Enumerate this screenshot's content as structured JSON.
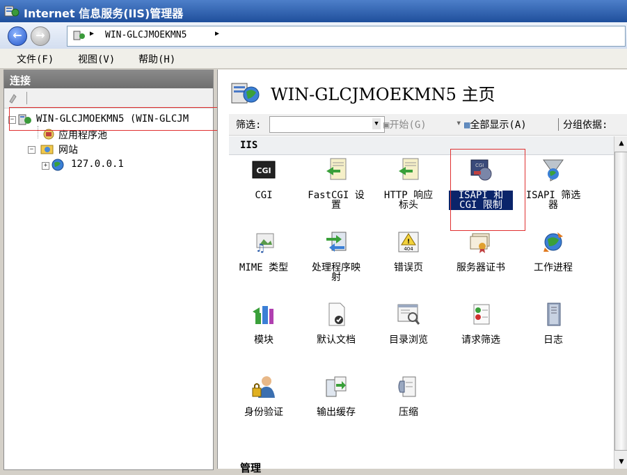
{
  "window": {
    "title": "Internet 信息服务(IIS)管理器"
  },
  "address": {
    "path": "WIN-GLCJMOEKMN5"
  },
  "menu": {
    "items": [
      "文件(F)",
      "视图(V)",
      "帮助(H)"
    ]
  },
  "connections": {
    "header": "连接",
    "tree": {
      "server": "WIN-GLCJMOEKMN5 (WIN-GLCJM",
      "app_pools": "应用程序池",
      "sites": "网站",
      "site1": "127.0.0.1"
    }
  },
  "home": {
    "title": "WIN-GLCJMOEKMN5 主页"
  },
  "filterbar": {
    "label": "筛选:",
    "start": "开始(G)",
    "show_all": "全部显示(A)",
    "group_by": "分组依据:"
  },
  "sections": {
    "iis": "IIS",
    "manage": "管理"
  },
  "features": [
    {
      "label": "CGI",
      "icon": "cgi-icon"
    },
    {
      "label": "FastCGI 设\n置",
      "icon": "fastcgi-icon"
    },
    {
      "label": "HTTP 响应\n标头",
      "icon": "http-headers-icon"
    },
    {
      "label": "ISAPI 和\nCGI 限制",
      "icon": "isapi-cgi-icon",
      "selected": true
    },
    {
      "label": "ISAPI 筛选\n器",
      "icon": "isapi-filter-icon"
    },
    {
      "label": "MIME 类型",
      "icon": "mime-icon"
    },
    {
      "label": "处理程序映\n射",
      "icon": "handler-mapping-icon"
    },
    {
      "label": "错误页",
      "icon": "error-page-icon",
      "badge": "404"
    },
    {
      "label": "服务器证书",
      "icon": "certificate-icon"
    },
    {
      "label": "工作进程",
      "icon": "worker-process-icon"
    },
    {
      "label": "模块",
      "icon": "modules-icon"
    },
    {
      "label": "默认文档",
      "icon": "default-document-icon"
    },
    {
      "label": "目录浏览",
      "icon": "directory-browsing-icon"
    },
    {
      "label": "请求筛选",
      "icon": "request-filtering-icon"
    },
    {
      "label": "日志",
      "icon": "logging-icon"
    },
    {
      "label": "身份验证",
      "icon": "authentication-icon"
    },
    {
      "label": "输出缓存",
      "icon": "output-cache-icon"
    },
    {
      "label": "压缩",
      "icon": "compression-icon"
    }
  ],
  "colors": {
    "selection": "#0a246a",
    "highlight_box": "#e03030",
    "titlebar": "#2a5aa8"
  }
}
